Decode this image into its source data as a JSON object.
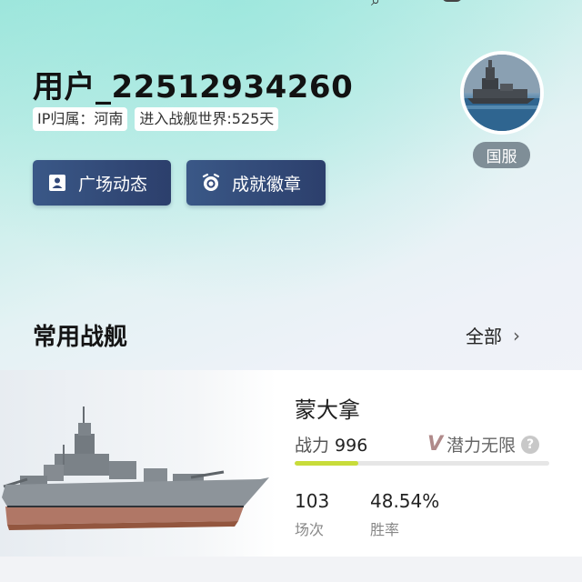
{
  "profile": {
    "username": "用户_22512934260",
    "ip_location": "IP归属：河南",
    "days_in_world": "进入战舰世界:525天",
    "server": "国服"
  },
  "actions": {
    "plaza": "广场动态",
    "badges": "成就徽章"
  },
  "common_ships": {
    "title": "常用战舰",
    "view_all": "全部",
    "ship": {
      "name": "蒙大拿",
      "power_label": "战力",
      "power_value": "996",
      "potential": "潜力无限",
      "power_bar_fraction": 0.25,
      "battles_value": "103",
      "battles_label": "场次",
      "winrate_value": "48.54%",
      "winrate_label": "胜率"
    }
  },
  "icons": {
    "plaza": "person-card-icon",
    "badges": "alarm-clock-icon",
    "view_all": "chevron-right-icon",
    "help": "question-circle-icon"
  },
  "colors": {
    "button": "#2f4675",
    "bar_fill": "#c8dc3a",
    "server_badge": "#7f8e97"
  }
}
